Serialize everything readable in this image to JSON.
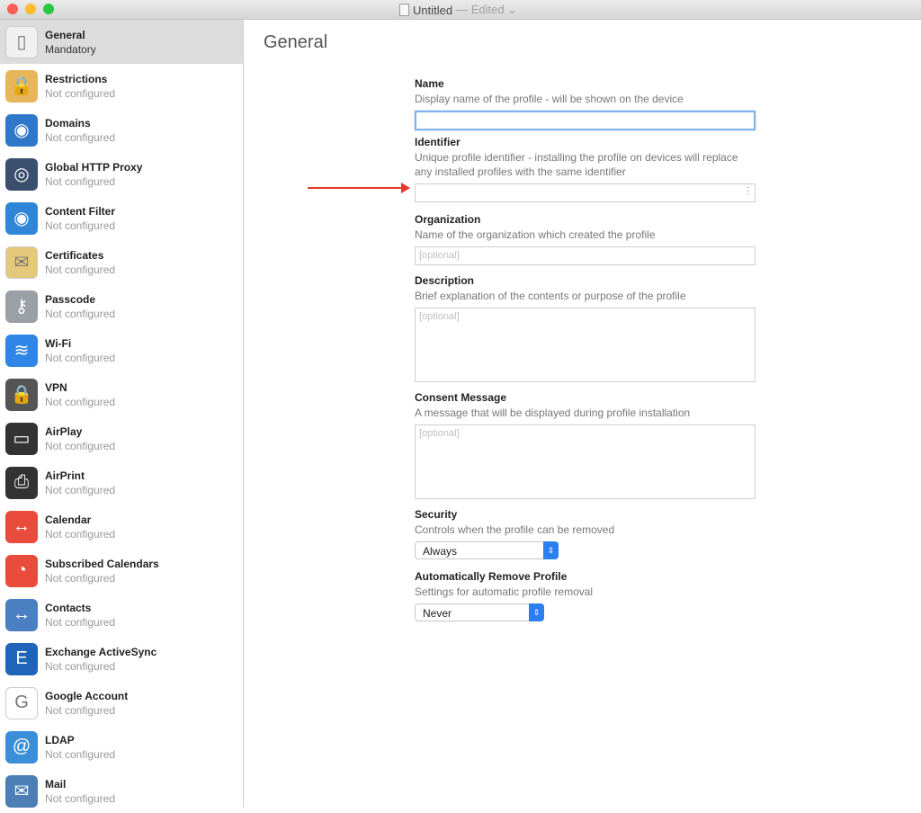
{
  "window": {
    "title": "Untitled",
    "status": "— Edited ⌄"
  },
  "sidebar": {
    "items": [
      {
        "title": "General",
        "sub": "Mandatory",
        "icon": "switch-icon",
        "glyph": "▯",
        "color": "#f0f0f0"
      },
      {
        "title": "Restrictions",
        "sub": "Not configured",
        "icon": "padlocks-icon",
        "glyph": "🔒",
        "color": "#e7b55a"
      },
      {
        "title": "Domains",
        "sub": "Not configured",
        "icon": "globe-icon",
        "glyph": "◉",
        "color": "#2f78c9"
      },
      {
        "title": "Global HTTP Proxy",
        "sub": "Not configured",
        "icon": "proxy-globe-icon",
        "glyph": "◎",
        "color": "#3b4f6e"
      },
      {
        "title": "Content Filter",
        "sub": "Not configured",
        "icon": "filter-globe-icon",
        "glyph": "◉",
        "color": "#2f86d6"
      },
      {
        "title": "Certificates",
        "sub": "Not configured",
        "icon": "certificate-icon",
        "glyph": "✉",
        "color": "#e5c87a"
      },
      {
        "title": "Passcode",
        "sub": "Not configured",
        "icon": "key-icon",
        "glyph": "⚷",
        "color": "#9aa0a6"
      },
      {
        "title": "Wi-Fi",
        "sub": "Not configured",
        "icon": "wifi-icon",
        "glyph": "≋",
        "color": "#2f86e6"
      },
      {
        "title": "VPN",
        "sub": "Not configured",
        "icon": "vpn-lock-icon",
        "glyph": "🔒",
        "color": "#555"
      },
      {
        "title": "AirPlay",
        "sub": "Not configured",
        "icon": "airplay-icon",
        "glyph": "▭",
        "color": "#333"
      },
      {
        "title": "AirPrint",
        "sub": "Not configured",
        "icon": "printer-icon",
        "glyph": "⎙",
        "color": "#333"
      },
      {
        "title": "Calendar",
        "sub": "Not configured",
        "icon": "calendar-icon",
        "glyph": "↔",
        "color": "#e94b3c"
      },
      {
        "title": "Subscribed Calendars",
        "sub": "Not configured",
        "icon": "subscribed-calendar-icon",
        "glyph": "◔",
        "color": "#e94b3c"
      },
      {
        "title": "Contacts",
        "sub": "Not configured",
        "icon": "contacts-icon",
        "glyph": "↔",
        "color": "#4a7fc1"
      },
      {
        "title": "Exchange ActiveSync",
        "sub": "Not configured",
        "icon": "exchange-icon",
        "glyph": "E",
        "color": "#1f64b8"
      },
      {
        "title": "Google Account",
        "sub": "Not configured",
        "icon": "google-icon",
        "glyph": "G",
        "color": "#ffffff"
      },
      {
        "title": "LDAP",
        "sub": "Not configured",
        "icon": "ldap-icon",
        "glyph": "@",
        "color": "#3a8fd8"
      },
      {
        "title": "Mail",
        "sub": "Not configured",
        "icon": "mail-icon",
        "glyph": "✉",
        "color": "#4b7fb6"
      }
    ]
  },
  "main": {
    "heading": "General",
    "name": {
      "label": "Name",
      "desc": "Display name of the profile - will be shown on the device",
      "value": ""
    },
    "identifier": {
      "label": "Identifier",
      "desc": "Unique profile identifier - installing the profile on devices will replace any installed profiles with the same identifier",
      "value": ""
    },
    "organization": {
      "label": "Organization",
      "desc": "Name of the organization which created the profile",
      "placeholder": "[optional]"
    },
    "description": {
      "label": "Description",
      "desc": "Brief explanation of the contents or purpose of the profile",
      "placeholder": "[optional]"
    },
    "consent": {
      "label": "Consent Message",
      "desc": "A message that will be displayed during profile installation",
      "placeholder": "[optional]"
    },
    "security": {
      "label": "Security",
      "desc": "Controls when the profile can be removed",
      "value": "Always"
    },
    "auto_remove": {
      "label": "Automatically Remove Profile",
      "desc": "Settings for automatic profile removal",
      "value": "Never"
    }
  },
  "annotation": {
    "arrow_color": "#e53b2a"
  }
}
